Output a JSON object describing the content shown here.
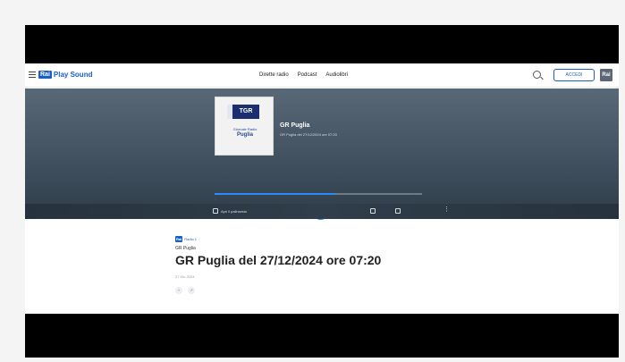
{
  "nav": {
    "brand_box": "Rai",
    "brand_name": "Play Sound",
    "links": [
      "Dirette radio",
      "Podcast",
      "Audiolibri"
    ],
    "login_label": "ACCEDI",
    "corner_badge": "Rai"
  },
  "player": {
    "artwork": {
      "logo_text": "TGR",
      "subtitle_line1": "Giornale Radio",
      "subtitle_line2": "Puglia"
    },
    "title": "GR Puglia",
    "subtitle": "GR Puglia del 27/12/2024 ore 07:20",
    "progress_fraction": 0.58,
    "strip_label": "Apri il palinsesto",
    "accent_color": "#2d8bff"
  },
  "info": {
    "channel_box": "Rai",
    "channel_name": "Radio 1",
    "program": "GR Puglia",
    "episode_title": "GR Puglia del 27/12/2024 ore 07:20",
    "date": "27 Dic 2024"
  },
  "icons": [
    "menu-icon",
    "search-icon",
    "volume-icon",
    "skip-back-icon",
    "replay-icon",
    "pause-icon",
    "forward-icon",
    "skip-next-icon",
    "share-icon",
    "pin-icon",
    "download-icon",
    "more-icon"
  ]
}
